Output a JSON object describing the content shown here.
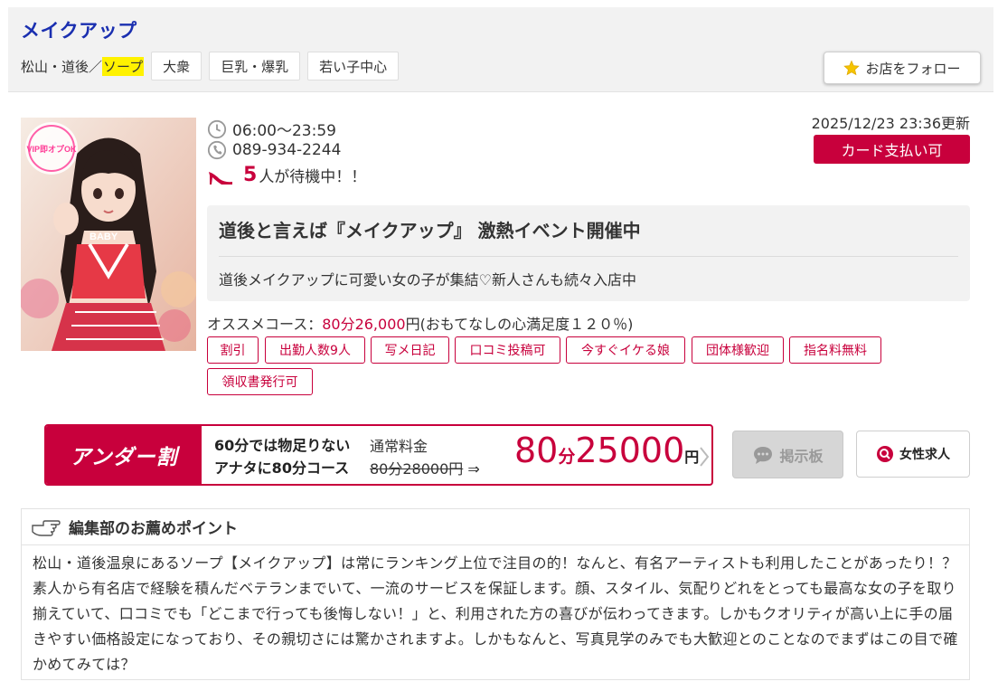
{
  "header": {
    "shop_name": "メイクアップ",
    "area": "松山・道後／",
    "genre": "ソープ",
    "tags": [
      "大衆",
      "巨乳・爆乳",
      "若い子中心"
    ],
    "follow_label": "お店をフォロー"
  },
  "photo": {
    "badge_text": "VIP即オプOK",
    "shirt_text": "BABY"
  },
  "info": {
    "hours": "06:00〜23:59",
    "phone": "089-934-2244",
    "waiting_count": "5",
    "waiting_suffix": "人が待機中！！",
    "updated": "2025/12/23 23:36更新",
    "card_label": "カード支払い可"
  },
  "event": {
    "title": "道後と言えば『メイクアップ』 激熱イベント開催中",
    "description": "道後メイクアップに可愛い女の子が集結♡新人さんも続々入店中"
  },
  "course": {
    "label": "オススメコース：",
    "price": "80分26,000",
    "suffix": "円(おもてなしの心満足度１２０％)"
  },
  "features": [
    "割引",
    "出勤人数9人",
    "写メ日記",
    "口コミ投稿可",
    "今すぐイケる娘",
    "団体様歓迎",
    "指名料無料",
    "領収書発行可"
  ],
  "under": {
    "logo": "アンダー割",
    "line1": "60分では物足りない",
    "line2": "アナタに80分コース",
    "normal_label": "通常料金",
    "old_price": "80分28000円",
    "arrow": " ⇒",
    "new_minutes": "80",
    "minute_unit": "分",
    "new_price": "25000",
    "yen": "円"
  },
  "buttons": {
    "bbs": "掲示板",
    "job": "女性求人"
  },
  "recommend": {
    "title": "編集部のお薦めポイント",
    "text": "松山・道後温泉にあるソープ【メイクアップ】は常にランキング上位で注目の的！なんと、有名アーティストも利用したことがあったり！？素人から有名店で経験を積んだベテランまでいて、一流のサービスを保証します。顔、スタイル、気配りどれをとっても最高な女の子を取り揃えていて、口コミでも「どこまで行っても後悔しない！」と、利用された方の喜びが伝わってきます。しかもクオリティが高い上に手の届きやすい価格設定になっており、その親切さには驚かされますよ。しかもなんと、写真見学のみでも大歓迎とのことなのでまずはこの目で確かめてみては？"
  },
  "colors": {
    "accent": "#c8003c",
    "shop_name": "#1a2fb0",
    "highlight": "#fff200"
  }
}
